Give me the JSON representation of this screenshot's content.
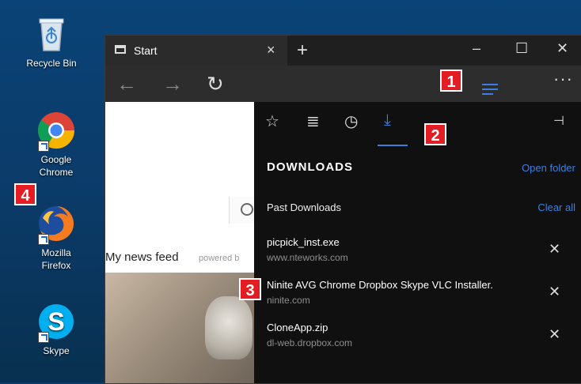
{
  "desktop": {
    "icons": [
      {
        "label": "Recycle Bin"
      },
      {
        "label": "Google Chrome"
      },
      {
        "label": "Mozilla Firefox"
      },
      {
        "label": "Skype"
      }
    ]
  },
  "browser": {
    "tab_title": "Start",
    "tab_close": "×",
    "new_tab": "+",
    "window_controls": {
      "minimize": "–",
      "maximize": "☐",
      "close": "✕"
    },
    "toolbar": {
      "back": "←",
      "forward": "→",
      "refresh": "↻",
      "more": "···"
    },
    "page": {
      "news_feed": "My news feed",
      "powered": "powered b"
    }
  },
  "hub": {
    "tabs": [
      {
        "icon": "star-icon",
        "glyph": "☆"
      },
      {
        "icon": "reading-list-icon",
        "glyph": "≣"
      },
      {
        "icon": "history-icon",
        "glyph": "◷"
      },
      {
        "icon": "download-icon",
        "glyph": "⤓"
      }
    ],
    "pin": "⊣",
    "heading": "DOWNLOADS",
    "open_folder": "Open folder",
    "past_downloads": "Past Downloads",
    "clear_all": "Clear all",
    "items": [
      {
        "name": "picpick_inst.exe",
        "source": "www.nteworks.com",
        "close": "✕"
      },
      {
        "name": "Ninite AVG Chrome Dropbox Skype VLC Installer.",
        "source": "ninite.com",
        "close": "✕"
      },
      {
        "name": "CloneApp.zip",
        "source": "dl-web.dropbox.com",
        "close": "✕"
      }
    ]
  },
  "callouts": [
    "1",
    "2",
    "3",
    "4"
  ],
  "colors": {
    "accent": "#3d7fe0",
    "callout": "#e21d24"
  }
}
